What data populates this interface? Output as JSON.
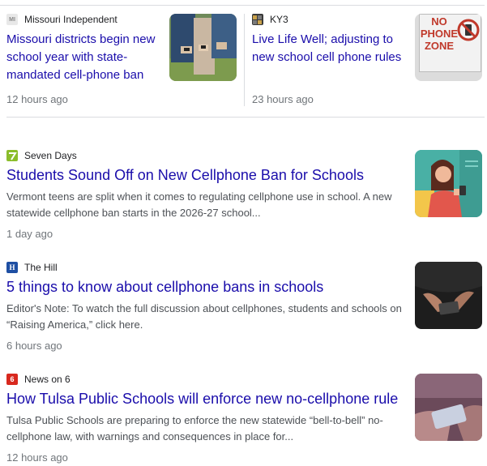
{
  "top_cards": [
    {
      "source": "Missouri Independent",
      "favicon": "MI",
      "title": "Missouri districts begin new school year with state-mandated cell-phone ban",
      "time": "12 hours ago"
    },
    {
      "source": "KY3",
      "favicon": "",
      "title": "Live Life Well; adjusting to new school cell phone rules",
      "time": "23 hours ago",
      "thumb_text": "NO PHONE ZONE"
    }
  ],
  "articles": [
    {
      "source": "Seven Days",
      "title": "Students Sound Off on New Cellphone Ban for Schools",
      "snippet_line1": "Vermont teens are split when it comes to regulating cellphone use in school. A new",
      "snippet_line2": "statewide cellphone ban starts in the 2026-27 school...",
      "time": "1 day ago"
    },
    {
      "source": "The Hill",
      "favicon": "H",
      "title": "5 things to know about cellphone bans in schools",
      "snippet_line1": "Editor's Note: To watch the full discussion about cellphones, students and schools on",
      "snippet_line2": "“Raising America,” click here.",
      "time": "6 hours ago"
    },
    {
      "source": "News on 6",
      "favicon": "6",
      "title": "How Tulsa Public Schools will enforce new no-cellphone rule",
      "snippet_line1": "Tulsa Public Schools are preparing to enforce the new statewide “bell-to-bell” no-",
      "snippet_line2": "cellphone law, with warnings and consequences in place for...",
      "time": "12 hours ago"
    }
  ],
  "colors": {
    "link": "#1a0dab",
    "snippet": "#4d5156",
    "meta": "#70757a"
  }
}
